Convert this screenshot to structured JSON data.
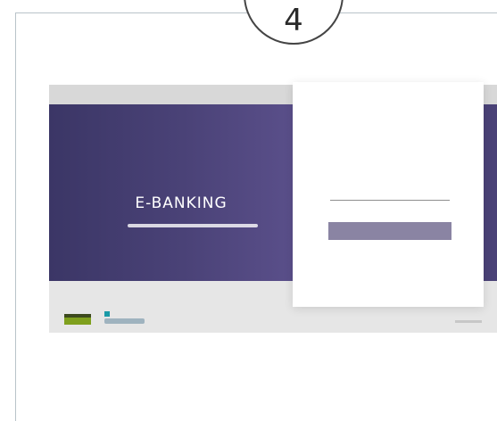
{
  "step": {
    "number": "4"
  },
  "screen": {
    "hero": {
      "title": "E-BANKING"
    },
    "login": {
      "input_value": ""
    }
  },
  "colors": {
    "hero": "#4a4277",
    "button": "#8a84a3",
    "logo_green": "#7fa01e",
    "logo_teal": "#1a9aa7",
    "frame_border": "#b9c3c9"
  }
}
